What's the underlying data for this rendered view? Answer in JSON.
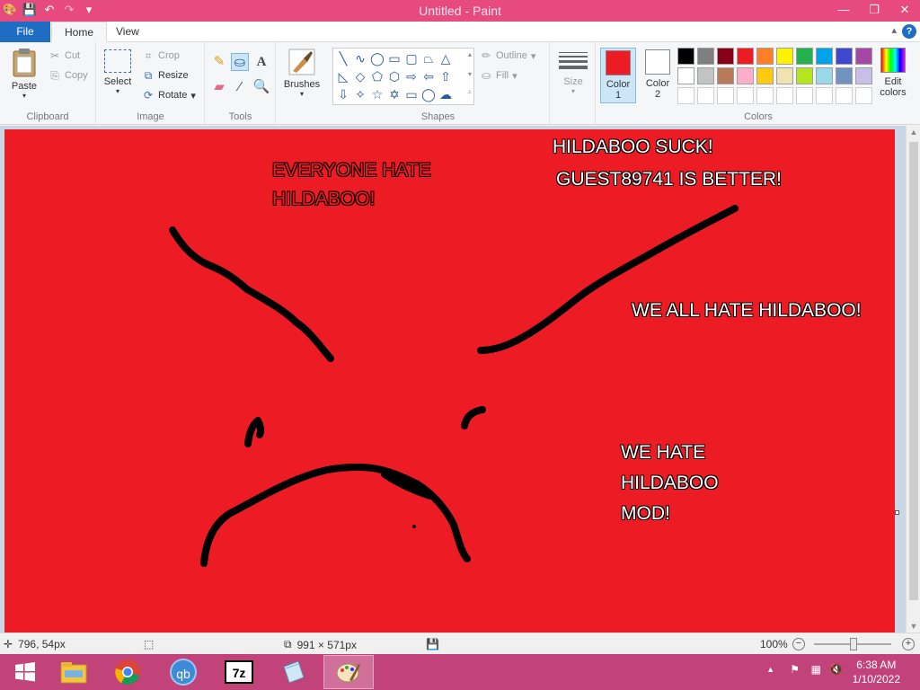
{
  "window": {
    "title": "Untitled - Paint"
  },
  "qat": {
    "icons": [
      "paint-app-icon",
      "save-icon",
      "undo-icon",
      "redo-icon",
      "customize-icon"
    ]
  },
  "tabs": {
    "file": "File",
    "home": "Home",
    "view": "View"
  },
  "clipboard": {
    "paste": "Paste",
    "cut": "Cut",
    "copy": "Copy",
    "group": "Clipboard"
  },
  "image": {
    "select": "Select",
    "crop": "Crop",
    "resize": "Resize",
    "rotate": "Rotate",
    "group": "Image"
  },
  "tools": {
    "group": "Tools"
  },
  "brushes": {
    "label": "Brushes"
  },
  "shapes": {
    "outline": "Outline",
    "fill": "Fill",
    "group": "Shapes"
  },
  "size": {
    "label": "Size"
  },
  "colors": {
    "color1_label": "Color",
    "color1_num": "1",
    "color2_label": "Color",
    "color2_num": "2",
    "color1_value": "#ed1c24",
    "color2_value": "#ffffff",
    "edit_label": "Edit",
    "edit_label2": "colors",
    "group": "Colors",
    "palette_row1": [
      "#000000",
      "#7f7f7f",
      "#880015",
      "#ed1c24",
      "#ff7f27",
      "#fff200",
      "#22b14c",
      "#00a2e8",
      "#3f48cc",
      "#a349a4"
    ],
    "palette_row2": [
      "#ffffff",
      "#c3c3c3",
      "#b97a57",
      "#ffaec9",
      "#ffc90e",
      "#efe4b0",
      "#b5e61d",
      "#99d9ea",
      "#7092be",
      "#c8bfe7"
    ]
  },
  "canvas": {
    "background": "#ed1c24",
    "texts": [
      {
        "text": "EVERYONE HATE"
      },
      {
        "text": "HILDABOO!"
      },
      {
        "text": "HILDABOO SUCK!"
      },
      {
        "text": "GUEST89741 IS BETTER!"
      },
      {
        "text": "WE ALL HATE HILDABOO!"
      },
      {
        "text": "WE HATE"
      },
      {
        "text": "HILDABOO"
      },
      {
        "text": "MOD!"
      }
    ]
  },
  "status": {
    "cursor_pos": "796, 54px",
    "canvas_size": "991 × 571px",
    "zoom": "100%"
  },
  "taskbar": {
    "apps": [
      "windows-start-icon",
      "file-explorer-icon",
      "chrome-icon",
      "qbittorrent-icon",
      "7zip-icon",
      "notepad-icon",
      "paint-icon"
    ],
    "time": "6:38 AM",
    "date": "1/10/2022"
  }
}
